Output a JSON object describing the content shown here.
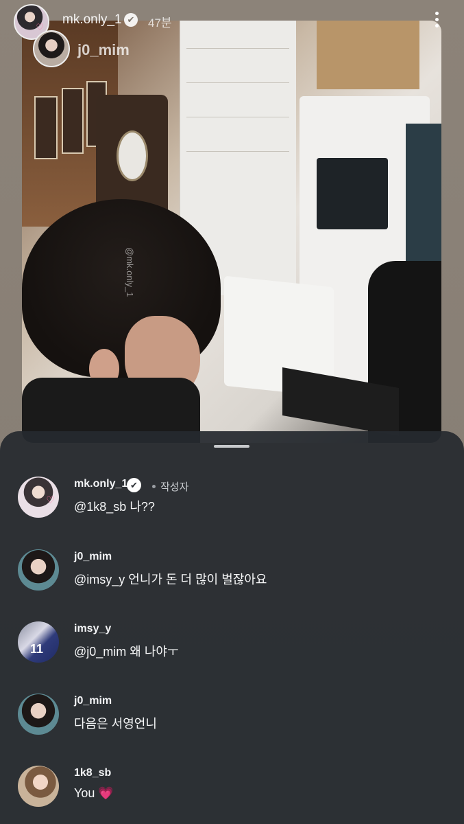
{
  "story": {
    "username": "mk.only_1",
    "time_ago": "47분",
    "mention": "j0_mim",
    "photo_watermark": "@mk.only_1"
  },
  "comments": [
    {
      "username": "mk.only_1",
      "verified": true,
      "author_label": "작성자",
      "text": "@1k8_sb 나??"
    },
    {
      "username": "j0_mim",
      "text": "@imsy_y 언니가 돈 더 많이 벌잖아요"
    },
    {
      "username": "imsy_y",
      "text": "@j0_mim 왜 나야ㅜ",
      "avatar_badge": "11"
    },
    {
      "username": "j0_mim",
      "text": "다음은 서영언니"
    },
    {
      "username": "1k8_sb",
      "text": "You",
      "emoji": "💗"
    }
  ],
  "icons": {
    "verified": "✔",
    "more": "more-vertical-icon",
    "heart": "♡"
  },
  "colors": {
    "sheet_bg": "#262a2f",
    "story_bg": "#8a8177",
    "heart_pink": "#ff5fa5"
  }
}
